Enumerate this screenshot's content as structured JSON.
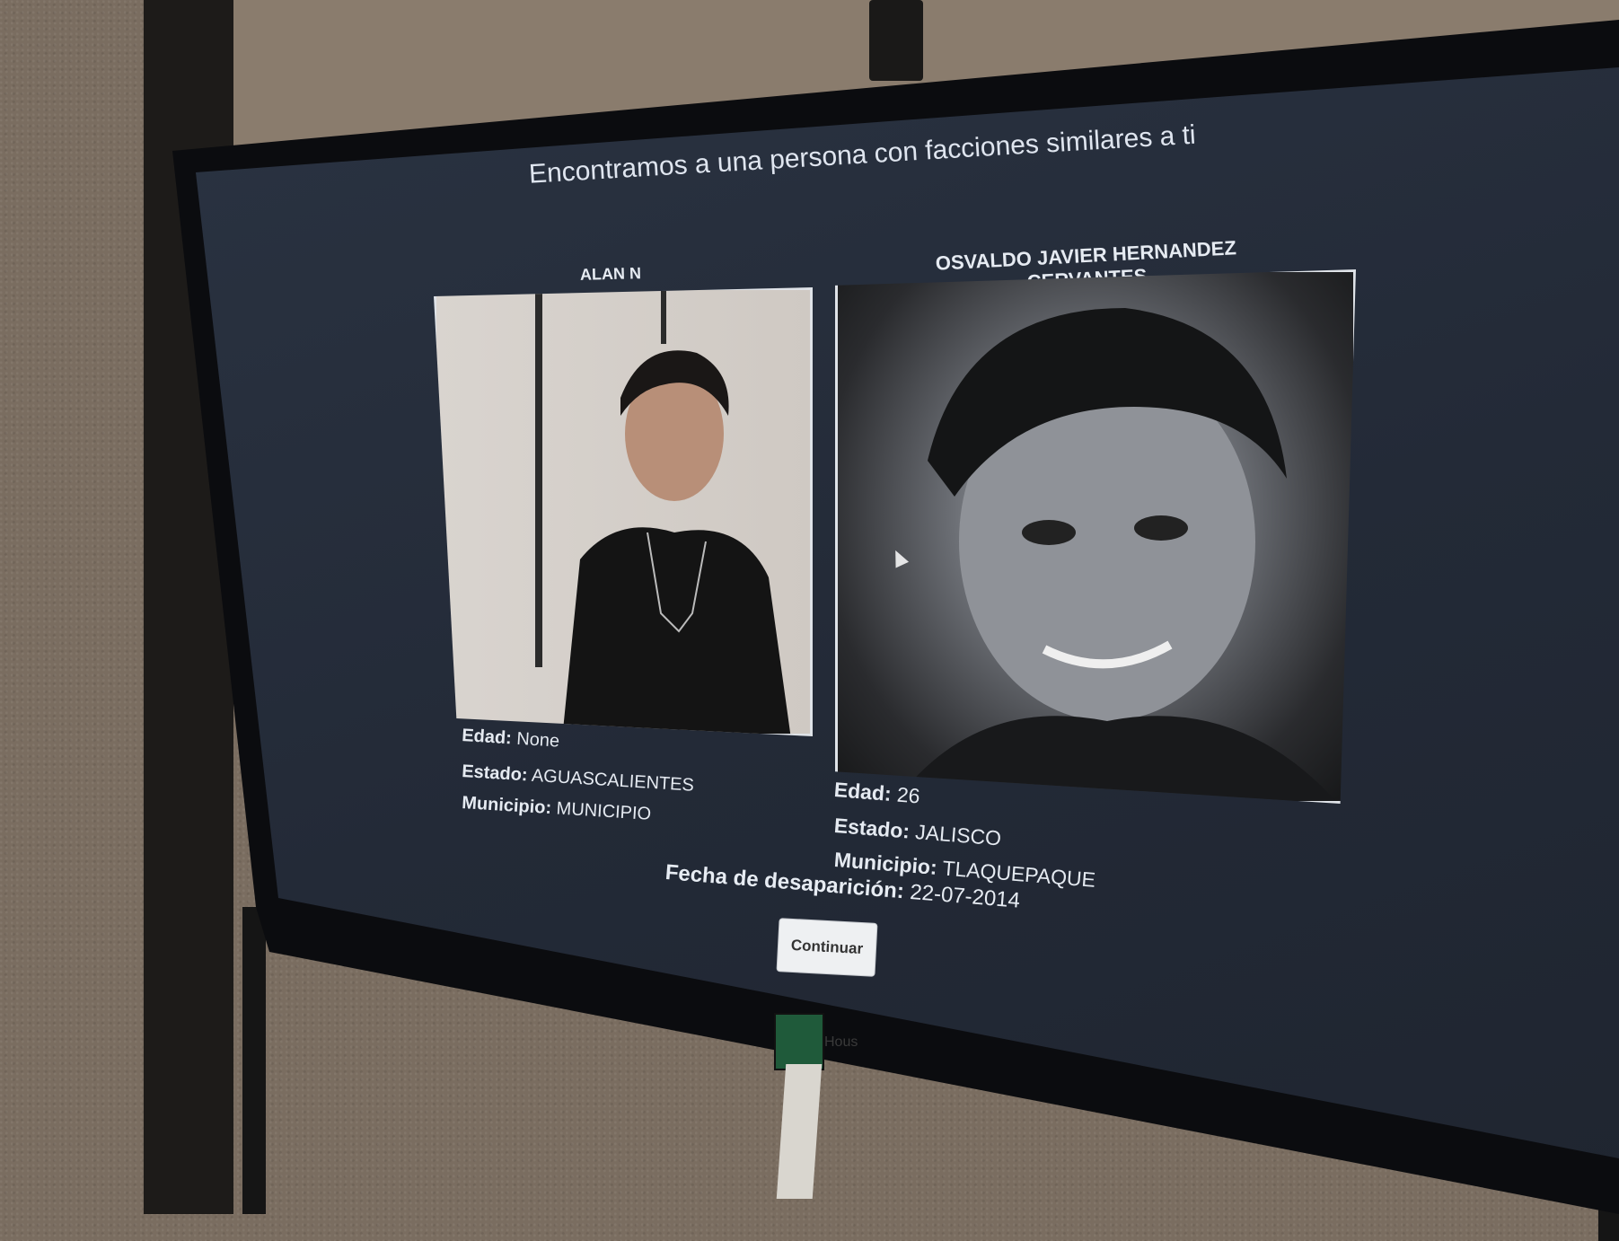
{
  "screen": {
    "headline": "Encontramos a una persona con facciones similares a ti",
    "left_person": {
      "name": "ALAN N",
      "edad_label": "Edad:",
      "edad_value": "None",
      "estado_label": "Estado:",
      "estado_value": "AGUASCALIENTES",
      "municipio_label": "Municipio:",
      "municipio_value": "MUNICIPIO"
    },
    "right_person": {
      "name": "OSVALDO JAVIER HERNANDEZ CERVANTES",
      "edad_label": "Edad:",
      "edad_value": "26",
      "estado_label": "Estado:",
      "estado_value": "JALISCO",
      "municipio_label": "Municipio:",
      "municipio_value": "TLAQUEPAQUE"
    },
    "fecha_label": "Fecha de desaparición:",
    "fecha_value": "22-07-2014",
    "continue_button": "Continuar"
  },
  "hardware": {
    "brand_text": "Hous"
  },
  "colors": {
    "screen_bg": "#252c39",
    "text": "#e5eaf1",
    "button_bg": "#eef0f2"
  }
}
